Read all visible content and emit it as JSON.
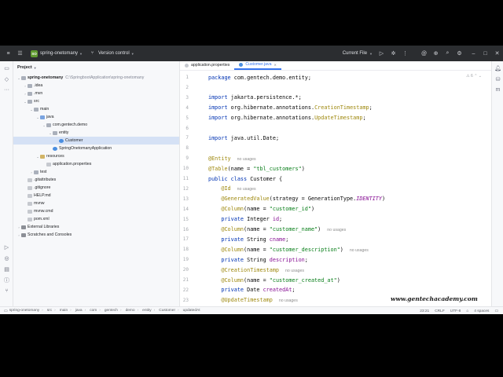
{
  "titlebar": {
    "project_badge": "SO",
    "project_name": "spring-onetomany",
    "vcs_label": "Version control",
    "run_config": "Current File"
  },
  "project_panel": {
    "header": "Project",
    "tree": [
      {
        "label": "spring-onetomany",
        "path": "C:\\SpringbootApplication\\spring-onetomany",
        "depth": 0,
        "icon": "folder-icon",
        "expanded": true,
        "bold": true
      },
      {
        "label": ".idea",
        "depth": 1,
        "icon": "folder-icon",
        "expanded": false
      },
      {
        "label": ".mvn",
        "depth": 1,
        "icon": "folder-icon",
        "expanded": false
      },
      {
        "label": "src",
        "depth": 1,
        "icon": "folder-icon",
        "expanded": true
      },
      {
        "label": "main",
        "depth": 2,
        "icon": "folder-icon",
        "expanded": true
      },
      {
        "label": "java",
        "depth": 3,
        "icon": "source-folder-icon",
        "expanded": true
      },
      {
        "label": "com.gentech.demo",
        "depth": 4,
        "icon": "package-icon",
        "expanded": true
      },
      {
        "label": "entity",
        "depth": 5,
        "icon": "package-icon",
        "expanded": true
      },
      {
        "label": "Customer",
        "depth": 6,
        "icon": "class-icon",
        "selected": true
      },
      {
        "label": "SpringOnetomanyApplication",
        "depth": 5,
        "icon": "class-icon"
      },
      {
        "label": "resources",
        "depth": 3,
        "icon": "resources-folder-icon",
        "expanded": true
      },
      {
        "label": "application.properties",
        "depth": 4,
        "icon": "properties-file-icon"
      },
      {
        "label": "test",
        "depth": 2,
        "icon": "folder-icon",
        "expanded": false
      },
      {
        "label": ".gitattributes",
        "depth": 1,
        "icon": "file-icon"
      },
      {
        "label": ".gitignore",
        "depth": 1,
        "icon": "file-icon"
      },
      {
        "label": "HELP.md",
        "depth": 1,
        "icon": "markdown-file-icon"
      },
      {
        "label": "mvnw",
        "depth": 1,
        "icon": "file-icon"
      },
      {
        "label": "mvnw.cmd",
        "depth": 1,
        "icon": "file-icon"
      },
      {
        "label": "pom.xml",
        "depth": 1,
        "icon": "maven-file-icon"
      },
      {
        "label": "External Libraries",
        "depth": 0,
        "icon": "library-icon",
        "expanded": false
      },
      {
        "label": "Scratches and Consoles",
        "depth": 0,
        "icon": "scratches-icon",
        "expanded": false
      }
    ]
  },
  "editor": {
    "tabs": [
      {
        "label": "application.properties",
        "active": false
      },
      {
        "label": "Customer.java",
        "active": true
      }
    ],
    "inspection_count": "6",
    "lines": [
      {
        "n": "1",
        "tokens": [
          [
            "kw",
            "package"
          ],
          [
            "",
            "com.gentech.demo.entity;"
          ]
        ]
      },
      {
        "n": "2",
        "tokens": []
      },
      {
        "n": "3",
        "tokens": [
          [
            "kw",
            "import"
          ],
          [
            "",
            "jakarta.persistence.*;"
          ]
        ]
      },
      {
        "n": "4",
        "tokens": [
          [
            "kw",
            "import"
          ],
          [
            "",
            "org.hibernate.annotations."
          ],
          [
            "ann",
            "CreationTimestamp"
          ],
          [
            "",
            ";"
          ]
        ]
      },
      {
        "n": "5",
        "tokens": [
          [
            "kw",
            "import"
          ],
          [
            "",
            "org.hibernate.annotations."
          ],
          [
            "ann",
            "UpdateTimestamp"
          ],
          [
            "",
            ";"
          ]
        ]
      },
      {
        "n": "6",
        "tokens": []
      },
      {
        "n": "7",
        "tokens": [
          [
            "kw",
            "import"
          ],
          [
            "",
            "java.util.Date;"
          ]
        ]
      },
      {
        "n": "8",
        "tokens": []
      },
      {
        "n": "9",
        "tokens": [
          [
            "ann",
            "@Entity"
          ]
        ],
        "hint": "no usages"
      },
      {
        "n": "10",
        "tokens": [
          [
            "ann",
            "@Table"
          ],
          [
            "",
            "(name = "
          ],
          [
            "str",
            "\"tbl_customers\""
          ],
          [
            "",
            ")"
          ]
        ]
      },
      {
        "n": "11",
        "tokens": [
          [
            "kw",
            "public class"
          ],
          [
            "",
            "Customer {"
          ]
        ]
      },
      {
        "n": "12",
        "tokens": [
          [
            "ann",
            "    @Id"
          ]
        ],
        "hint": "no usages"
      },
      {
        "n": "13",
        "tokens": [
          [
            "ann",
            "    @GeneratedValue"
          ],
          [
            "",
            "(strategy = GenerationType."
          ],
          [
            "cls-it",
            "IDENTITY"
          ],
          [
            "",
            ")"
          ]
        ]
      },
      {
        "n": "14",
        "tokens": [
          [
            "ann",
            "    @Column"
          ],
          [
            "",
            "(name = "
          ],
          [
            "str",
            "\"customer_id\""
          ],
          [
            "",
            ")"
          ]
        ]
      },
      {
        "n": "15",
        "tokens": [
          [
            "kw",
            "    private"
          ],
          [
            "",
            "Integer "
          ],
          [
            "fld",
            "id"
          ],
          [
            "",
            ";"
          ]
        ]
      },
      {
        "n": "16",
        "tokens": [
          [
            "ann",
            "    @Column"
          ],
          [
            "",
            "(name = "
          ],
          [
            "str",
            "\"customer_name\""
          ],
          [
            "",
            ")"
          ]
        ],
        "hint": "no usages"
      },
      {
        "n": "17",
        "tokens": [
          [
            "kw",
            "    private"
          ],
          [
            "",
            "String "
          ],
          [
            "fld",
            "cname"
          ],
          [
            "",
            ";"
          ]
        ]
      },
      {
        "n": "18",
        "tokens": [
          [
            "ann",
            "    @Column"
          ],
          [
            "",
            "(name = "
          ],
          [
            "str",
            "\"customer_description\""
          ],
          [
            "",
            ")"
          ]
        ],
        "hint": "no usages"
      },
      {
        "n": "19",
        "tokens": [
          [
            "kw",
            "    private"
          ],
          [
            "",
            "String "
          ],
          [
            "fld",
            "description"
          ],
          [
            "",
            ";"
          ]
        ]
      },
      {
        "n": "20",
        "tokens": [
          [
            "ann",
            "    @CreationTimestamp"
          ]
        ],
        "hint": "no usages"
      },
      {
        "n": "21",
        "tokens": [
          [
            "ann",
            "    @Column"
          ],
          [
            "",
            "(name = "
          ],
          [
            "str",
            "\"customer_created_at\""
          ],
          [
            "",
            ")"
          ]
        ]
      },
      {
        "n": "22",
        "tokens": [
          [
            "kw",
            "    private"
          ],
          [
            "",
            "Date "
          ],
          [
            "fld",
            "createdAt"
          ],
          [
            "",
            ";"
          ]
        ]
      },
      {
        "n": "23",
        "tokens": [
          [
            "ann",
            "    @UpdateTimestamp"
          ]
        ],
        "hint": "no usages"
      }
    ]
  },
  "statusbar": {
    "breadcrumbs": [
      "spring-onetomany",
      "src",
      "main",
      "java",
      "com",
      "gentech",
      "demo",
      "entity",
      "Customer",
      "updatedAt"
    ],
    "cursor": "23:21",
    "line_sep": "CRLF",
    "encoding": "UTF-8",
    "indent": "4 spaces"
  },
  "watermark": "www.gentechacademy.com"
}
